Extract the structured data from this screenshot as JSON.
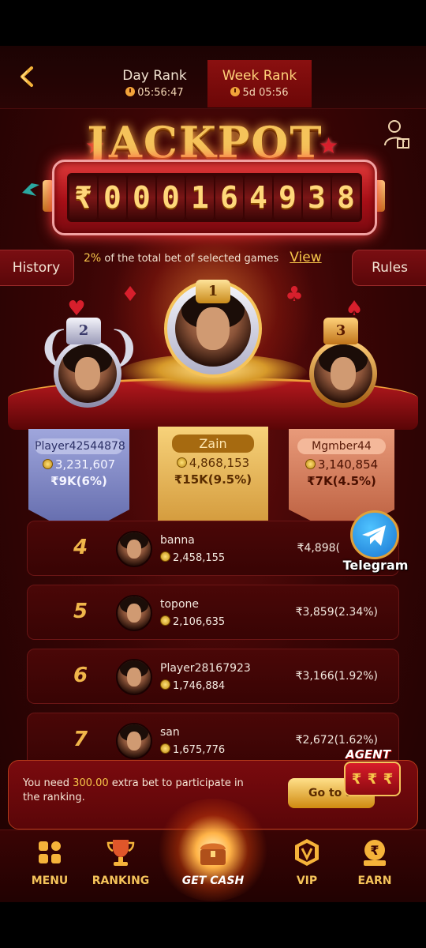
{
  "header": {
    "tabs": [
      {
        "label": "Day Rank",
        "countdown": "05:56:47"
      },
      {
        "label": "Week Rank",
        "countdown": "5d 05:56"
      }
    ]
  },
  "jackpot": {
    "title": "JACKPOT",
    "currency": "₹",
    "digits": [
      "0",
      "0",
      "0",
      "1",
      "6",
      "4",
      "9",
      "3",
      "8"
    ],
    "info_percent": "2%",
    "info_text": "of the total bet of selected games",
    "view_label": "View",
    "history_label": "History",
    "rules_label": "Rules"
  },
  "podium": [
    {
      "rank": "2",
      "name": "Player42544878",
      "score": "3,231,607",
      "reward": "₹9K(6%)"
    },
    {
      "rank": "1",
      "name": "Zain",
      "score": "4,868,153",
      "reward": "₹15K(9.5%)"
    },
    {
      "rank": "3",
      "name": "Mgmber44",
      "score": "3,140,854",
      "reward": "₹7K(4.5%)"
    }
  ],
  "ranking": [
    {
      "rank": "4",
      "name": "banna",
      "score": "2,458,155",
      "reward": "₹4,898("
    },
    {
      "rank": "5",
      "name": "topone",
      "score": "2,106,635",
      "reward": "₹3,859(2.34%)"
    },
    {
      "rank": "6",
      "name": "Player28167923",
      "score": "1,746,884",
      "reward": "₹3,166(1.92%)"
    },
    {
      "rank": "7",
      "name": "san",
      "score": "1,675,776",
      "reward": "₹2,672(1.62%)"
    }
  ],
  "telegram_label": "Telegram",
  "prompt": {
    "text_before": "You need ",
    "amount": "300.00",
    "text_after": " extra bet to participate in the ranking.",
    "goto_label": "Go to a"
  },
  "agent": {
    "label": "AGENT",
    "symbols": [
      "₹",
      "₹",
      "₹"
    ]
  },
  "nav": [
    {
      "label": "MENU",
      "icon": "menu-grid-icon"
    },
    {
      "label": "RANKING",
      "icon": "trophy-icon"
    },
    {
      "label": "GET CASH",
      "icon": "treasure-chest-icon"
    },
    {
      "label": "VIP",
      "icon": "vip-badge-icon"
    },
    {
      "label": "EARN",
      "icon": "rupee-bag-icon"
    }
  ],
  "colors": {
    "gold": "#f5c35a",
    "bg": "#3a0505",
    "accent_red": "#a70f17"
  }
}
